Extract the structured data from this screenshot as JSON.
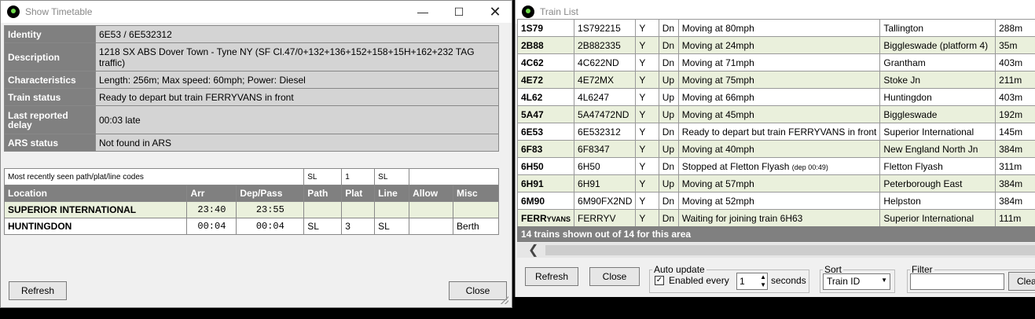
{
  "timetable_window": {
    "title": "Show Timetable",
    "info_rows": [
      {
        "key": "Identity",
        "value": "6E53 / 6E532312"
      },
      {
        "key": "Description",
        "value": "1218 SX ABS Dover Town - Tyne NY (SF Cl.47/0+132+136+152+158+15H+162+232 TAG traffic)"
      },
      {
        "key": "Characteristics",
        "value": "Length: 256m; Max speed: 60mph; Power: Diesel"
      },
      {
        "key": "Train status",
        "value": "Ready to depart but train FERRYVANS in front"
      },
      {
        "key": "Last reported delay",
        "value": "00:03 late"
      },
      {
        "key": "ARS status",
        "value": "Not found in ARS"
      }
    ],
    "path_header_row": [
      "Most recently seen path/plat/line codes",
      "SL",
      "1",
      "SL",
      ""
    ],
    "columns": [
      "Location",
      "Arr",
      "Dep/Pass",
      "Path",
      "Plat",
      "Line",
      "Allow",
      "Misc"
    ],
    "rows": [
      {
        "location": "SUPERIOR INTERNATIONAL",
        "arr": "23:40",
        "dep": "23:55",
        "path": "",
        "plat": "",
        "line": "",
        "allow": "",
        "misc": ""
      },
      {
        "location": "HUNTINGDON",
        "arr": "00:04",
        "dep": "00:04",
        "path": "SL",
        "plat": "3",
        "line": "SL",
        "allow": "",
        "misc": "Berth"
      }
    ],
    "refresh_label": "Refresh",
    "close_label": "Close"
  },
  "train_list_window": {
    "title": "Train List",
    "rows": [
      {
        "id": "1S79",
        "hc": "1S792215",
        "y": "Y",
        "dir": "Dn",
        "status": "Moving at 80mph",
        "status_note": "",
        "loc": "Tallington",
        "len": "288m"
      },
      {
        "id": "2B88",
        "hc": "2B882335",
        "y": "Y",
        "dir": "Dn",
        "status": "Moving at 24mph",
        "status_note": "",
        "loc": "Biggleswade (platform 4)",
        "len": "35m"
      },
      {
        "id": "4C62",
        "hc": "4C622ND",
        "y": "Y",
        "dir": "Dn",
        "status": "Moving at 71mph",
        "status_note": "",
        "loc": "Grantham",
        "len": "403m"
      },
      {
        "id": "4E72",
        "hc": "4E72MX",
        "y": "Y",
        "dir": "Up",
        "status": "Moving at 75mph",
        "status_note": "",
        "loc": "Stoke Jn",
        "len": "211m"
      },
      {
        "id": "4L62",
        "hc": "4L6247",
        "y": "Y",
        "dir": "Up",
        "status": "Moving at 66mph",
        "status_note": "",
        "loc": "Huntingdon",
        "len": "403m"
      },
      {
        "id": "5A47",
        "hc": "5A47472ND",
        "y": "Y",
        "dir": "Up",
        "status": "Moving at 45mph",
        "status_note": "",
        "loc": "Biggleswade",
        "len": "192m"
      },
      {
        "id": "6E53",
        "hc": "6E532312",
        "y": "Y",
        "dir": "Dn",
        "status": "Ready to depart but train FERRYVANS in front",
        "status_note": "",
        "loc": "Superior International",
        "len": "145m"
      },
      {
        "id": "6F83",
        "hc": "6F8347",
        "y": "Y",
        "dir": "Up",
        "status": "Moving at 40mph",
        "status_note": "",
        "loc": "New England North Jn",
        "len": "384m"
      },
      {
        "id": "6H50",
        "hc": "6H50",
        "y": "Y",
        "dir": "Dn",
        "status": "Stopped at Fletton Flyash",
        "status_note": "(dep 00:49)",
        "loc": "Fletton Flyash",
        "len": "311m"
      },
      {
        "id": "6H91",
        "hc": "6H91",
        "y": "Y",
        "dir": "Up",
        "status": "Moving at 57mph",
        "status_note": "",
        "loc": "Peterborough East",
        "len": "384m"
      },
      {
        "id": "6M90",
        "hc": "6M90FX2ND",
        "y": "Y",
        "dir": "Dn",
        "status": "Moving at 52mph",
        "status_note": "",
        "loc": "Helpston",
        "len": "384m"
      },
      {
        "id": "FERRYVANS",
        "hc": "FERRYV",
        "y": "Y",
        "dir": "Dn",
        "status": "Waiting for joining train 6H63",
        "status_note": "",
        "loc": "Superior International",
        "len": "111m"
      }
    ],
    "status_text": "14 trains shown out of 14 for this area",
    "refresh_label": "Refresh",
    "close_label": "Close",
    "auto_update_label": "Auto update",
    "enabled_label": "Enabled every",
    "interval": "1",
    "seconds_label": "seconds",
    "sort_label": "Sort",
    "sort_value": "Train ID",
    "filter_label": "Filter",
    "filter_value": "",
    "clear_label": "Clea"
  }
}
